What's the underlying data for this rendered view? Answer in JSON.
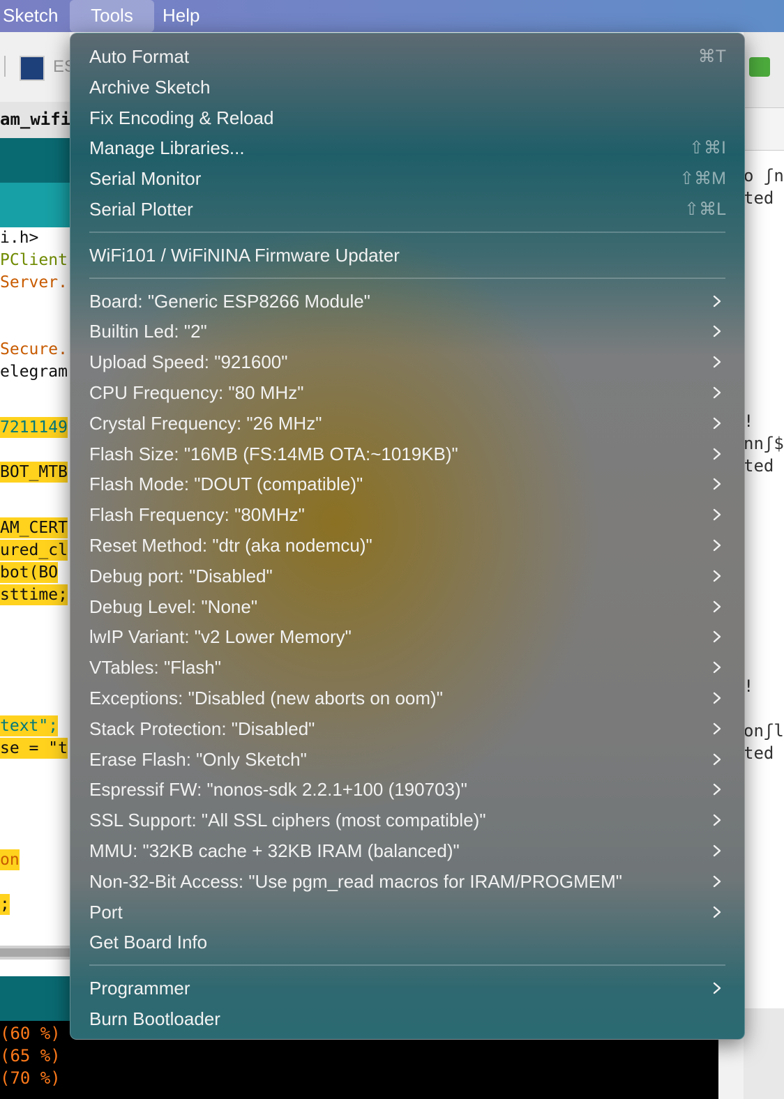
{
  "menubar": {
    "items": [
      {
        "label": "Sketch"
      },
      {
        "label": "Tools"
      },
      {
        "label": "Help"
      }
    ]
  },
  "editor": {
    "toolbar_label": "ES",
    "tab_name": "am_wifi",
    "code_lines": [
      {
        "text": "i.h>",
        "color": "#111111"
      },
      {
        "text": "PClient",
        "color": "#6f8a00"
      },
      {
        "text": "Server.",
        "color": "#c85b00"
      },
      {
        "text": "Secure.",
        "color": "#c85b00"
      },
      {
        "text": "elegram",
        "color": "#111111"
      },
      {
        "text": "7211149",
        "color": "#00797c"
      },
      {
        "text": "BOT_MTB",
        "color": "#111111"
      },
      {
        "text": "AM_CERT",
        "color": "#111111"
      },
      {
        "text": "ured_cl",
        "color": "#111111"
      },
      {
        "text": " bot(BO",
        "color": "#111111"
      },
      {
        "text": "sttime;",
        "color": "#111111"
      },
      {
        "text": "text\";",
        "color": "#00797c"
      },
      {
        "text": "se = \"t",
        "color": "#111111"
      },
      {
        "text": "on",
        "color": "#c85b00"
      },
      {
        "text": ";",
        "color": "#111111"
      }
    ],
    "console_lines": [
      "(60 %)",
      "(65 %)",
      "(70 %)"
    ]
  },
  "serial_monitor": {
    "lines": [
      "o ʃn'",
      "ted",
      "!",
      "nnʃ$",
      "ted",
      "!",
      "onʃl",
      "ted"
    ]
  },
  "tools_menu": {
    "sections": [
      [
        {
          "label": "Auto Format",
          "shortcut": "⌘T"
        },
        {
          "label": "Archive Sketch"
        },
        {
          "label": "Fix Encoding & Reload"
        },
        {
          "label": "Manage Libraries...",
          "shortcut": "⇧⌘I"
        },
        {
          "label": "Serial Monitor",
          "shortcut": "⇧⌘M"
        },
        {
          "label": "Serial Plotter",
          "shortcut": "⇧⌘L"
        }
      ],
      [
        {
          "label": "WiFi101 / WiFiNINA Firmware Updater"
        }
      ],
      [
        {
          "label": "Board: \"Generic ESP8266 Module\"",
          "submenu": true
        },
        {
          "label": "Builtin Led: \"2\"",
          "submenu": true
        },
        {
          "label": "Upload Speed: \"921600\"",
          "submenu": true
        },
        {
          "label": "CPU Frequency: \"80 MHz\"",
          "submenu": true
        },
        {
          "label": "Crystal Frequency: \"26 MHz\"",
          "submenu": true
        },
        {
          "label": "Flash Size: \"16MB (FS:14MB OTA:~1019KB)\"",
          "submenu": true
        },
        {
          "label": "Flash Mode: \"DOUT (compatible)\"",
          "submenu": true
        },
        {
          "label": "Flash Frequency: \"80MHz\"",
          "submenu": true
        },
        {
          "label": "Reset Method: \"dtr (aka nodemcu)\"",
          "submenu": true
        },
        {
          "label": "Debug port: \"Disabled\"",
          "submenu": true
        },
        {
          "label": "Debug Level: \"None\"",
          "submenu": true
        },
        {
          "label": "lwIP Variant: \"v2 Lower Memory\"",
          "submenu": true
        },
        {
          "label": "VTables: \"Flash\"",
          "submenu": true
        },
        {
          "label": "Exceptions: \"Disabled (new aborts on oom)\"",
          "submenu": true
        },
        {
          "label": "Stack Protection: \"Disabled\"",
          "submenu": true
        },
        {
          "label": "Erase Flash: \"Only Sketch\"",
          "submenu": true
        },
        {
          "label": "Espressif FW: \"nonos-sdk 2.2.1+100 (190703)\"",
          "submenu": true
        },
        {
          "label": "SSL Support: \"All SSL ciphers (most compatible)\"",
          "submenu": true
        },
        {
          "label": "MMU: \"32KB cache + 32KB IRAM (balanced)\"",
          "submenu": true
        },
        {
          "label": "Non-32-Bit Access: \"Use pgm_read macros for IRAM/PROGMEM\"",
          "submenu": true
        },
        {
          "label": "Port",
          "submenu": true
        },
        {
          "label": "Get Board Info"
        }
      ],
      [
        {
          "label": "Programmer",
          "submenu": true
        },
        {
          "label": "Burn Bootloader"
        }
      ]
    ]
  },
  "icons": {
    "submenu_arrow": "chevron-right-icon",
    "sketch_logo": "esp-logo-icon"
  }
}
